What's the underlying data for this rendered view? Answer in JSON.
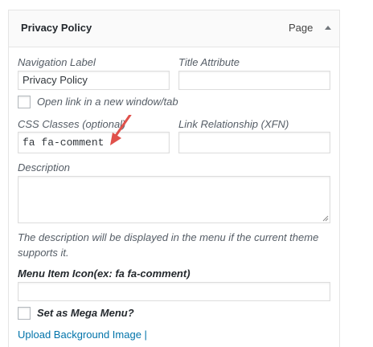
{
  "panel": {
    "title": "Privacy Policy",
    "type_label": "Page",
    "toggle_icon": "caret-up-icon"
  },
  "navigation_label": {
    "label": "Navigation Label",
    "value": "Privacy Policy"
  },
  "title_attribute": {
    "label": "Title Attribute",
    "value": ""
  },
  "open_new_window": {
    "label": "Open link in a new window/tab",
    "checked": false
  },
  "css_classes": {
    "label": "CSS Classes (optional)",
    "value": "fa fa-comment"
  },
  "link_relationship": {
    "label": "Link Relationship (XFN)",
    "value": ""
  },
  "description": {
    "label": "Description",
    "value": "",
    "help": "The description will be displayed in the menu if the current theme supports it."
  },
  "menu_item_icon": {
    "label": "Menu Item Icon(ex: fa fa-comment)",
    "value": ""
  },
  "mega_menu": {
    "label": "Set as Mega Menu?",
    "checked": false
  },
  "upload_link": "Upload Background Image |",
  "annotation": {
    "icon": "red-arrow-icon",
    "color": "#e0514b"
  }
}
